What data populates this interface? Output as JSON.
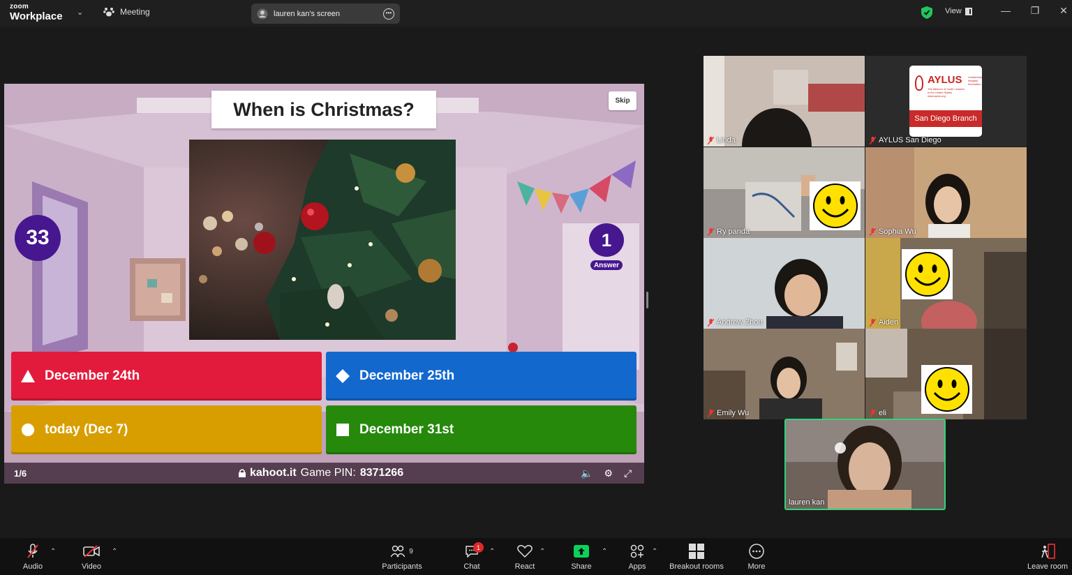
{
  "app": {
    "brand_small": "zoom",
    "brand_big": "Workplace"
  },
  "titlebar": {
    "meeting_label": "Meeting",
    "screen_share_label": "lauren kan's screen",
    "view_label": "View",
    "icons": [
      "chevron-down-icon",
      "paw-icon",
      "screen-share-icon",
      "more-icon",
      "shield-check-icon",
      "view-grid-icon",
      "minimize-icon",
      "restore-icon",
      "close-icon"
    ]
  },
  "kahoot": {
    "question": "When is Christmas?",
    "skip_label": "Skip",
    "timer": "33",
    "answers_count": "1",
    "answers_label": "Answer",
    "options": [
      {
        "shape": "triangle",
        "text": "December 24th",
        "color": "#e21b3c"
      },
      {
        "shape": "diamond",
        "text": "December 25th",
        "color": "#1368ce"
      },
      {
        "shape": "circle",
        "text": "today (Dec 7)",
        "color": "#d89e00"
      },
      {
        "shape": "square",
        "text": "December 31st",
        "color": "#26890c"
      }
    ],
    "progress": "1/6",
    "site": "kahoot.it",
    "pin_label": "Game PIN:",
    "pin": "8371266"
  },
  "participants": [
    {
      "name": "Linda"
    },
    {
      "name": "AYLUS San Diego",
      "logo_title": "AYLUS",
      "logo_sub1": "Leadership",
      "logo_sub2": "Integrity",
      "logo_sub3": "Innovation",
      "logo_desc1": "The Alliance of Youth Leaders",
      "logo_desc2": "in the United States",
      "logo_url": "www.aylus.org",
      "logo_branch": "San Diego Branch"
    },
    {
      "name": "Ry panda"
    },
    {
      "name": "Sophia Wu"
    },
    {
      "name": "Andrew Zhou"
    },
    {
      "name": "Aiden"
    },
    {
      "name": "Emily Wu"
    },
    {
      "name": "eli"
    }
  ],
  "self": {
    "name": "lauren kan"
  },
  "toolbar": {
    "audio": "Audio",
    "video": "Video",
    "participants": "Participants",
    "participants_count": "9",
    "chat": "Chat",
    "chat_badge": "1",
    "react": "React",
    "share": "Share",
    "apps": "Apps",
    "breakout": "Breakout rooms",
    "more": "More",
    "leave": "Leave room"
  },
  "colors": {
    "share_green": "#0bd15c",
    "kahoot_purple": "#46178f",
    "active_speaker": "#31d47a"
  }
}
